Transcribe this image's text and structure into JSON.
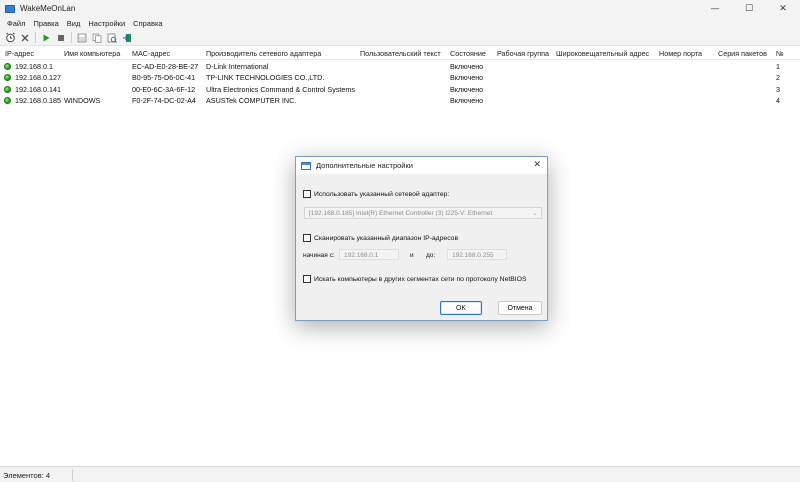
{
  "window": {
    "title": "WakeMeOnLan",
    "controls": {
      "minimize": "—",
      "maximize": "☐",
      "close": "✕"
    }
  },
  "menu": [
    "Файл",
    "Правка",
    "Вид",
    "Настройки",
    "Справка"
  ],
  "toolbar": {
    "icons": [
      "alarm-clock-icon",
      "delete-icon",
      "play-icon",
      "stop-icon",
      "save-icon",
      "copy-icon",
      "properties-icon",
      "exit-icon"
    ]
  },
  "list": {
    "columns": [
      "IP-адрес",
      "Имя компьютера",
      "MAC-адрес",
      "Производитель сетевого адаптера",
      "Пользовательский текст",
      "Состояние",
      "Рабочая группа",
      "Широковещательный адрес",
      "Номер порта",
      "Серия пакетов",
      "№"
    ],
    "rows": [
      {
        "ip": "192.168.0.1",
        "name": "",
        "mac": "EC-AD-E0-28-BE-27",
        "vendor": "D-Link International",
        "custom": "",
        "state": "Включено",
        "workgroup": "",
        "broadcast": "",
        "port": "",
        "series": "",
        "num": "1"
      },
      {
        "ip": "192.168.0.127",
        "name": "",
        "mac": "B0-95-75-D6-0C-41",
        "vendor": "TP-LINK TECHNOLOGIES CO.,LTD.",
        "custom": "",
        "state": "Включено",
        "workgroup": "",
        "broadcast": "",
        "port": "",
        "series": "",
        "num": "2"
      },
      {
        "ip": "192.168.0.141",
        "name": "",
        "mac": "00-E0-6C-3A-6F-12",
        "vendor": "Ultra Electronics Command & Control Systems",
        "custom": "",
        "state": "Включено",
        "workgroup": "",
        "broadcast": "",
        "port": "",
        "series": "",
        "num": "3"
      },
      {
        "ip": "192.168.0.185",
        "name": "WINDOWS",
        "mac": "F0-2F-74-DC-02-A4",
        "vendor": "ASUSTek COMPUTER INC.",
        "custom": "",
        "state": "Включено",
        "workgroup": "",
        "broadcast": "",
        "port": "",
        "series": "",
        "num": "4"
      }
    ]
  },
  "status": {
    "text": "Элементов: 4"
  },
  "dialog": {
    "title": "Дополнительные настройки",
    "close": "✕",
    "use_adapter_label": "Использовать указанный сетевой адаптер:",
    "adapter_value": "[192.168.0.185]  Intel(R) Ethernet Controller (3) I225-V:  Ethernet",
    "scan_range_label": "Сканировать указанный диапазон IP-адресов",
    "from_label": "начиная с:",
    "from_value": "192.168.0.1",
    "and_label": "и",
    "to_label": "до:",
    "to_value": "192.168.0.255",
    "netbios_label": "Искать компьютеры в других сегментах сети по протоколу NetBIOS",
    "ok_label": "OK",
    "cancel_label": "Отмена"
  }
}
